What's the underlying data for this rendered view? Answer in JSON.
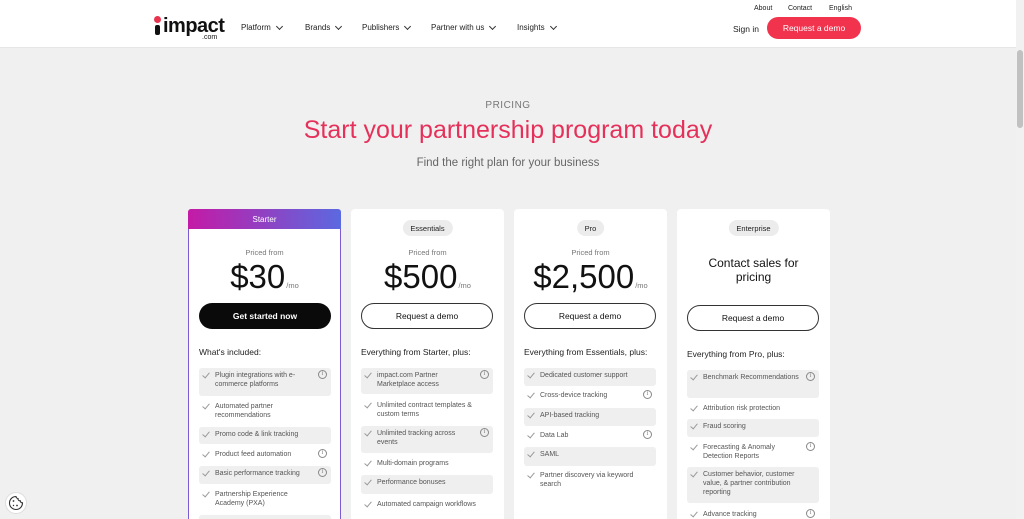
{
  "header": {
    "logo_text": "impact",
    "logo_sub": ".com",
    "nav": [
      {
        "label": "Platform"
      },
      {
        "label": "Brands"
      },
      {
        "label": "Publishers"
      },
      {
        "label": "Partner with us"
      },
      {
        "label": "Insights"
      }
    ],
    "utility": {
      "about": "About",
      "contact": "Contact",
      "language": "English"
    },
    "sign_in": "Sign in",
    "cta": "Request a demo",
    "accent_color": "#f2334e"
  },
  "hero": {
    "eyebrow": "PRICING",
    "title": "Start your partnership program today",
    "subtitle": "Find the right plan for your business"
  },
  "plans": [
    {
      "name": "Starter",
      "priced_from": "Priced from",
      "price": "$30",
      "per": "/mo",
      "cta": "Get started now",
      "included_label": "What's included:",
      "features": [
        {
          "text": "Plugin integrations with e-commerce platforms",
          "info": true,
          "shaded": true
        },
        {
          "text": "Automated partner recommendations",
          "info": false,
          "shaded": false
        },
        {
          "text": "Promo code & link tracking",
          "info": false,
          "shaded": true
        },
        {
          "text": "Product feed automation",
          "info": true,
          "shaded": false
        },
        {
          "text": "Basic performance tracking",
          "info": true,
          "shaded": true
        },
        {
          "text": "Partnership Experience Academy (PXA)",
          "info": false,
          "shaded": false
        }
      ]
    },
    {
      "name": "Essentials",
      "priced_from": "Priced from",
      "price": "$500",
      "per": "/mo",
      "cta": "Request a demo",
      "included_label": "Everything from Starter, plus:",
      "features": [
        {
          "text": "impact.com Partner Marketplace access",
          "info": true,
          "shaded": true
        },
        {
          "text": "Unlimited contract templates & custom terms",
          "info": false,
          "shaded": false
        },
        {
          "text": "Unlimited tracking across events",
          "info": true,
          "shaded": true
        },
        {
          "text": "Multi-domain programs",
          "info": false,
          "shaded": false
        },
        {
          "text": "Performance bonuses",
          "info": false,
          "shaded": true
        },
        {
          "text": "Automated campaign workflows",
          "info": false,
          "shaded": false
        }
      ]
    },
    {
      "name": "Pro",
      "priced_from": "Priced from",
      "price": "$2,500",
      "per": "/mo",
      "cta": "Request a demo",
      "included_label": "Everything from Essentials, plus:",
      "features": [
        {
          "text": "Dedicated customer support",
          "info": false,
          "shaded": true
        },
        {
          "text": "Cross-device tracking",
          "info": true,
          "shaded": false
        },
        {
          "text": "API-based tracking",
          "info": false,
          "shaded": true
        },
        {
          "text": "Data Lab",
          "info": true,
          "shaded": false
        },
        {
          "text": "SAML",
          "info": false,
          "shaded": true
        },
        {
          "text": "Partner discovery via keyword search",
          "info": false,
          "shaded": false
        }
      ]
    },
    {
      "name": "Enterprise",
      "contact_text": "Contact sales for pricing",
      "cta": "Request a demo",
      "included_label": "Everything from Pro, plus:",
      "features": [
        {
          "text": "Benchmark Recommendations",
          "info": true,
          "shaded": true
        },
        {
          "text": "Attribution risk protection",
          "info": false,
          "shaded": false
        },
        {
          "text": "Fraud scoring",
          "info": false,
          "shaded": true
        },
        {
          "text": "Forecasting & Anomaly Detection Reports",
          "info": true,
          "shaded": false
        },
        {
          "text": "Customer behavior, customer value, & partner contribution reporting",
          "info": false,
          "shaded": true
        },
        {
          "text": "Advance tracking",
          "info": true,
          "shaded": false
        }
      ]
    }
  ],
  "colors": {
    "title": "#e5315a",
    "starter_gradient_start": "#c41aa6",
    "starter_gradient_end": "#5b69e0"
  }
}
